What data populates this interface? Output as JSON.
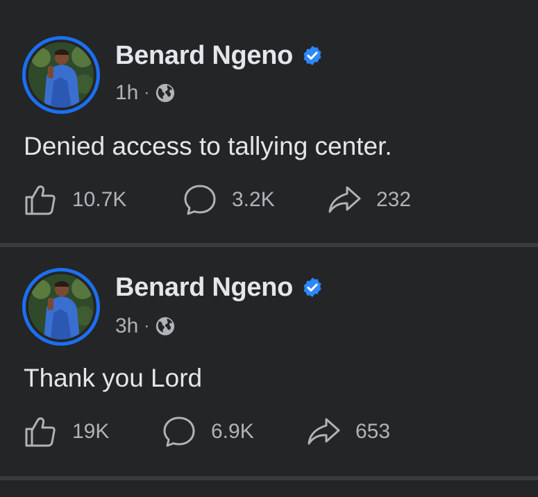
{
  "posts": [
    {
      "author": "Benard Ngeno",
      "time": "1h",
      "separator": "·",
      "text": "Denied access to tallying center.",
      "likes": "10.7K",
      "comments": "3.2K",
      "shares": "232"
    },
    {
      "author": "Benard Ngeno",
      "time": "3h",
      "separator": "·",
      "text": "Thank you Lord",
      "likes": "19K",
      "comments": "6.9K",
      "shares": "653"
    }
  ],
  "icons": {
    "verified": "verified-badge-icon",
    "audience": "globe-icon",
    "like": "thumbs-up-icon",
    "comment": "comment-bubble-icon",
    "share": "share-arrow-icon"
  },
  "colors": {
    "background": "#242526",
    "divider": "#3a3b3c",
    "primary_text": "#e4e6eb",
    "secondary_text": "#b0b3b8",
    "accent": "#1b6ff2"
  }
}
